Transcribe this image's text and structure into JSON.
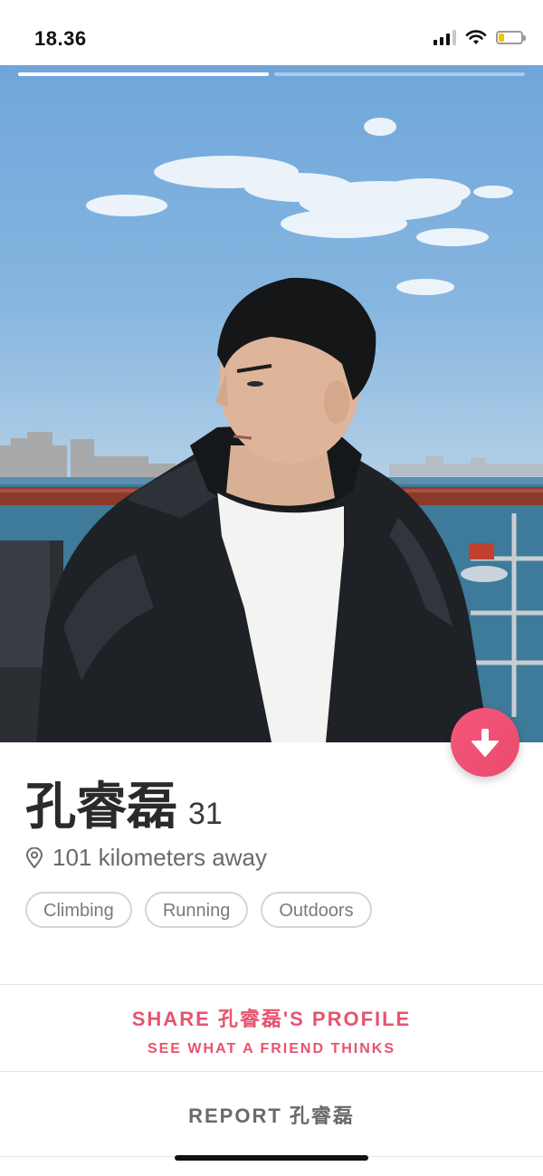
{
  "status_bar": {
    "time": "18.36",
    "battery_level": 0.25,
    "battery_color": "#f2c200",
    "icons": [
      "signal-icon",
      "wifi-icon",
      "battery-icon"
    ]
  },
  "photo": {
    "progress_segments": 2,
    "active_segment": 0
  },
  "profile": {
    "name": "孔睿磊",
    "age": "31",
    "distance": "101 kilometers away",
    "interests": [
      "Climbing",
      "Running",
      "Outdoors"
    ]
  },
  "actions": {
    "share_title": "SHARE 孔睿磊'S PROFILE",
    "share_subtitle": "SEE WHAT A FRIEND THINKS",
    "report": "REPORT 孔睿磊"
  },
  "colors": {
    "accent": "#e8536f",
    "fab_gradient_start": "#f5577a",
    "fab_gradient_end": "#e94a6e"
  }
}
